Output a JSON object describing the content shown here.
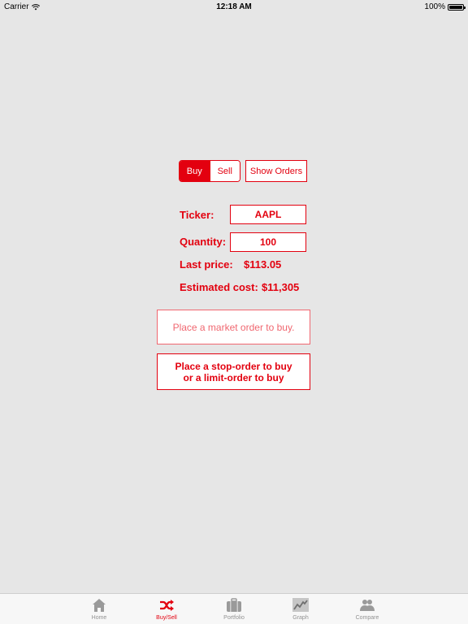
{
  "status_bar": {
    "carrier": "Carrier",
    "time": "12:18 AM",
    "battery": "100%"
  },
  "segmented": {
    "buy_label": "Buy",
    "sell_label": "Sell",
    "selected": "Buy"
  },
  "show_orders_label": "Show Orders",
  "form": {
    "ticker_label": "Ticker:",
    "ticker_value": "AAPL",
    "quantity_label": "Quantity:",
    "quantity_value": "100",
    "last_price_label": "Last price:",
    "last_price_value": "$113.05",
    "estimated_cost_label": "Estimated cost:",
    "estimated_cost_value": "$11,305"
  },
  "actions": {
    "market_order_label": "Place a market order to buy.",
    "stop_order_label": "Place a stop-order to buy\nor a limit-order to buy"
  },
  "tab_bar": {
    "tabs": [
      {
        "label": "Home",
        "icon": "home-icon"
      },
      {
        "label": "Buy/Sell",
        "icon": "shuffle-icon"
      },
      {
        "label": "Portfolio",
        "icon": "briefcase-icon"
      },
      {
        "label": "Graph",
        "icon": "graph-icon"
      },
      {
        "label": "Compare",
        "icon": "people-icon"
      }
    ],
    "active": "Buy/Sell"
  },
  "colors": {
    "accent": "#e3000f",
    "background": "#e6e6e6",
    "tab_inactive": "#929292"
  }
}
